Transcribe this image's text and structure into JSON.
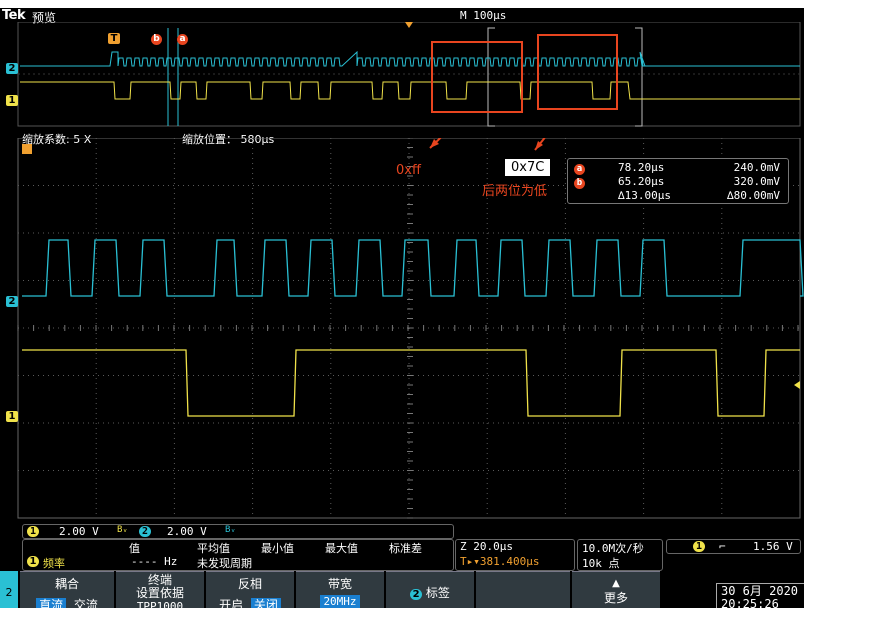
{
  "header": {
    "brand": "Tek",
    "title": "预览",
    "timebase": "M 100µs"
  },
  "zoom": {
    "factor_label": "缩放系数: 5 X",
    "position_label": "缩放位置： 580µs"
  },
  "markers": {
    "trigger": "T",
    "cursor_b": "b",
    "cursor_a": "a"
  },
  "channels": {
    "ch2_label": "2",
    "ch1_label": "1"
  },
  "annotations": {
    "left_value": "0xff",
    "right_value": "0x7C",
    "right_note": "后两位为低"
  },
  "cursors": {
    "a_time": "78.20µs",
    "a_volt": "240.0mV",
    "b_time": "65.20µs",
    "b_volt": "320.0mV",
    "delta_time": "∆13.00µs",
    "delta_volt": "∆80.00mV"
  },
  "status": {
    "ch1_num": "1",
    "ch1_scale": "2.00 V",
    "ch1_bw": "Bᵥ",
    "ch2_num": "2",
    "ch2_scale": "2.00 V",
    "ch2_bw": "Bᵥ",
    "meas_headers": [
      "值",
      "平均值",
      "最小值",
      "最大值",
      "标准差"
    ],
    "meas_ch": "1",
    "meas_name": "频率",
    "meas_value": "---- Hz",
    "meas_note": "未发现周期",
    "z_scale": "Z 20.0µs",
    "trig_pos": "T▸▾381.400µs",
    "sample_rate": "10.0M次/秒",
    "record_len": "10k 点",
    "trig_ch": "1",
    "trig_slope": "⌐",
    "trig_level": "1.56 V"
  },
  "menu": {
    "side_ch": "2",
    "coupling_title": "耦合",
    "coupling_dc": "直流",
    "coupling_ac": "交流",
    "termination_title": "终端",
    "termination_sub": "设置依据",
    "termination_probe": "TPP1000",
    "invert_title": "反相",
    "invert_on": "开启",
    "invert_off": "关闭",
    "bandwidth_title": "带宽",
    "bandwidth_value": "20MHz",
    "label_ch": "2",
    "label_title": "标签",
    "more": "更多"
  },
  "datetime": {
    "date": "30 6月 2020",
    "time": "20:25:26"
  },
  "colors": {
    "ch1": "#f0e24a",
    "ch2": "#2ac0d4",
    "annotation": "#e8451f",
    "grid": "#5a5a5a"
  }
}
